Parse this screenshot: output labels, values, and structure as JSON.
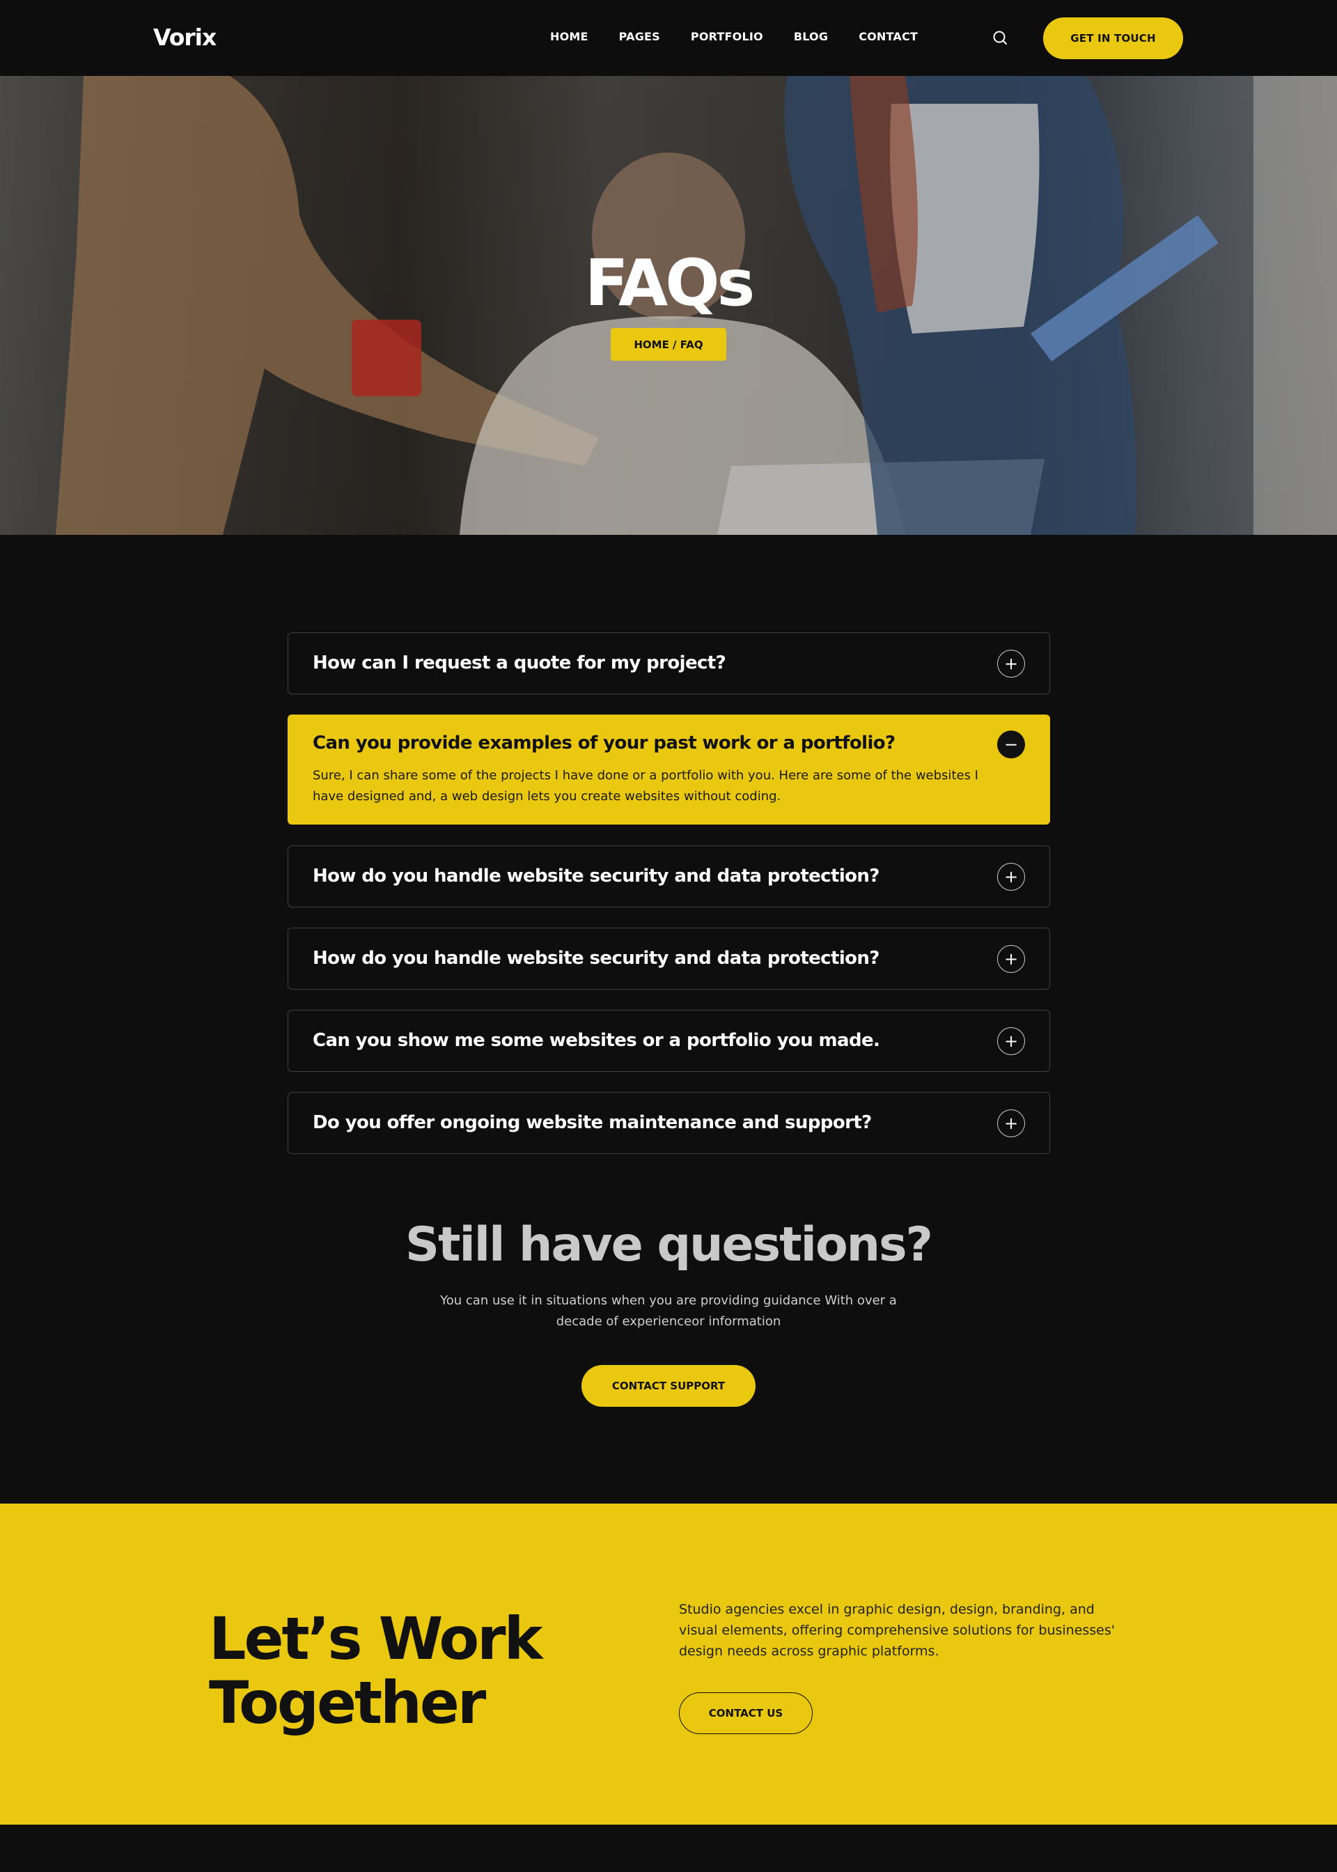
{
  "header": {
    "logo": "Vorix",
    "nav": [
      "HOME",
      "PAGES",
      "PORTFOLIO",
      "BLOG",
      "CONTACT"
    ],
    "cta": "GET IN TOUCH",
    "search_icon": "search-icon"
  },
  "hero": {
    "title": "FAQs",
    "breadcrumb": "HOME / FAQ"
  },
  "faq": {
    "items": [
      {
        "question": "How can I request a quote for my project?",
        "open": false
      },
      {
        "question": "Can you provide examples of your past work or a portfolio?",
        "open": true,
        "answer": "Sure, I can share some of the projects I have done or a portfolio with you. Here are some of the websites I have designed and, a web design lets you create websites without coding."
      },
      {
        "question": "How do you handle website security and data protection?",
        "open": false
      },
      {
        "question": "How do you handle website security and data protection?",
        "open": false
      },
      {
        "question": "Can you show me some websites or a portfolio you made.",
        "open": false
      },
      {
        "question": "Do you offer ongoing website maintenance and support?",
        "open": false
      }
    ],
    "plus_icon": "+",
    "minus_icon": "−"
  },
  "support": {
    "title": "Still have questions?",
    "text": "You can use it in situations when you are providing guidance With over a decade of experienceor information",
    "button": "CONTACT SUPPORT"
  },
  "cta_band": {
    "title_line1": "Let’s Work",
    "title_line2": "Together",
    "text": "Studio agencies excel in graphic design, design, branding, and visual elements, offering comprehensive solutions for businesses' design needs across graphic platforms.",
    "button": "CONTACT US"
  },
  "colors": {
    "accent": "#eac80f",
    "background": "#0e0e0e",
    "text_dark": "#111111"
  }
}
